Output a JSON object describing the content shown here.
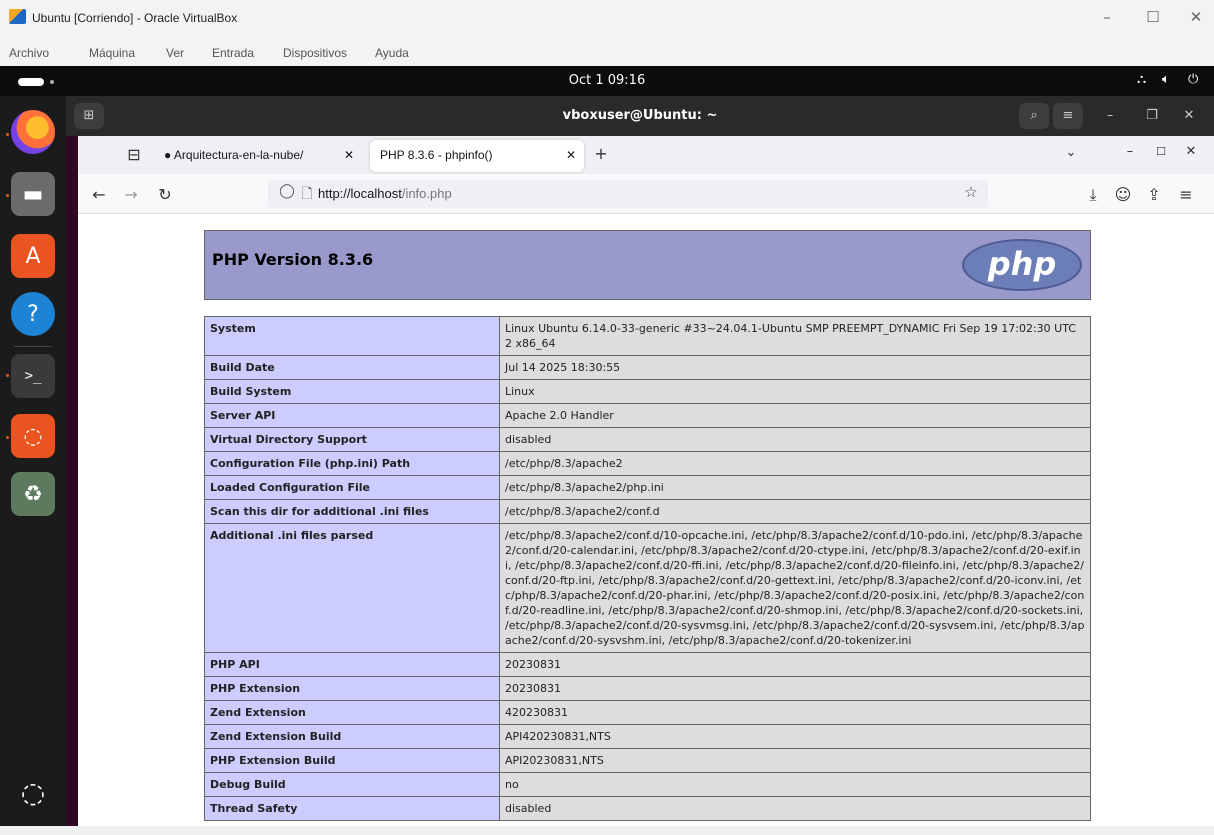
{
  "vbox": {
    "title": "Ubuntu [Corriendo] - Oracle VirtualBox",
    "menu": [
      "Archivo",
      "Máquina",
      "Ver",
      "Entrada",
      "Dispositivos",
      "Ayuda"
    ]
  },
  "gnome": {
    "clock": "Oct 1  09:16"
  },
  "terminal": {
    "title": "vboxuser@Ubuntu: ~"
  },
  "firefox": {
    "tabs": [
      {
        "label": "Arquitectura-en-la-nube/"
      },
      {
        "label": "PHP 8.3.6 - phpinfo()"
      }
    ],
    "url_host": "http://localhost",
    "url_path": "/info.php"
  },
  "phpinfo": {
    "version": "PHP Version 8.3.6",
    "logo": "php",
    "rows": [
      {
        "key": "System",
        "value": "Linux Ubuntu 6.14.0-33-generic #33~24.04.1-Ubuntu SMP PREEMPT_DYNAMIC Fri Sep 19 17:02:30 UTC 2 x86_64"
      },
      {
        "key": "Build Date",
        "value": "Jul 14 2025 18:30:55"
      },
      {
        "key": "Build System",
        "value": "Linux"
      },
      {
        "key": "Server API",
        "value": "Apache 2.0 Handler"
      },
      {
        "key": "Virtual Directory Support",
        "value": "disabled"
      },
      {
        "key": "Configuration File (php.ini) Path",
        "value": "/etc/php/8.3/apache2"
      },
      {
        "key": "Loaded Configuration File",
        "value": "/etc/php/8.3/apache2/php.ini"
      },
      {
        "key": "Scan this dir for additional .ini files",
        "value": "/etc/php/8.3/apache2/conf.d"
      },
      {
        "key": "Additional .ini files parsed",
        "value": "/etc/php/8.3/apache2/conf.d/10-opcache.ini, /etc/php/8.3/apache2/conf.d/10-pdo.ini, /etc/php/8.3/apache2/conf.d/20-calendar.ini, /etc/php/8.3/apache2/conf.d/20-ctype.ini, /etc/php/8.3/apache2/conf.d/20-exif.ini, /etc/php/8.3/apache2/conf.d/20-ffi.ini, /etc/php/8.3/apache2/conf.d/20-fileinfo.ini, /etc/php/8.3/apache2/conf.d/20-ftp.ini, /etc/php/8.3/apache2/conf.d/20-gettext.ini, /etc/php/8.3/apache2/conf.d/20-iconv.ini, /etc/php/8.3/apache2/conf.d/20-phar.ini, /etc/php/8.3/apache2/conf.d/20-posix.ini, /etc/php/8.3/apache2/conf.d/20-readline.ini, /etc/php/8.3/apache2/conf.d/20-shmop.ini, /etc/php/8.3/apache2/conf.d/20-sockets.ini, /etc/php/8.3/apache2/conf.d/20-sysvmsg.ini, /etc/php/8.3/apache2/conf.d/20-sysvsem.ini, /etc/php/8.3/apache2/conf.d/20-sysvshm.ini, /etc/php/8.3/apache2/conf.d/20-tokenizer.ini"
      },
      {
        "key": "PHP API",
        "value": "20230831"
      },
      {
        "key": "PHP Extension",
        "value": "20230831"
      },
      {
        "key": "Zend Extension",
        "value": "420230831"
      },
      {
        "key": "Zend Extension Build",
        "value": "API420230831,NTS"
      },
      {
        "key": "PHP Extension Build",
        "value": "API20230831,NTS"
      },
      {
        "key": "Debug Build",
        "value": "no"
      },
      {
        "key": "Thread Safety",
        "value": "disabled"
      }
    ]
  },
  "colors": {
    "php_header": "#9999cc",
    "php_key_cell": "#ccccff",
    "php_value_cell": "#dddddd",
    "ubuntu_orange": "#e95420"
  }
}
